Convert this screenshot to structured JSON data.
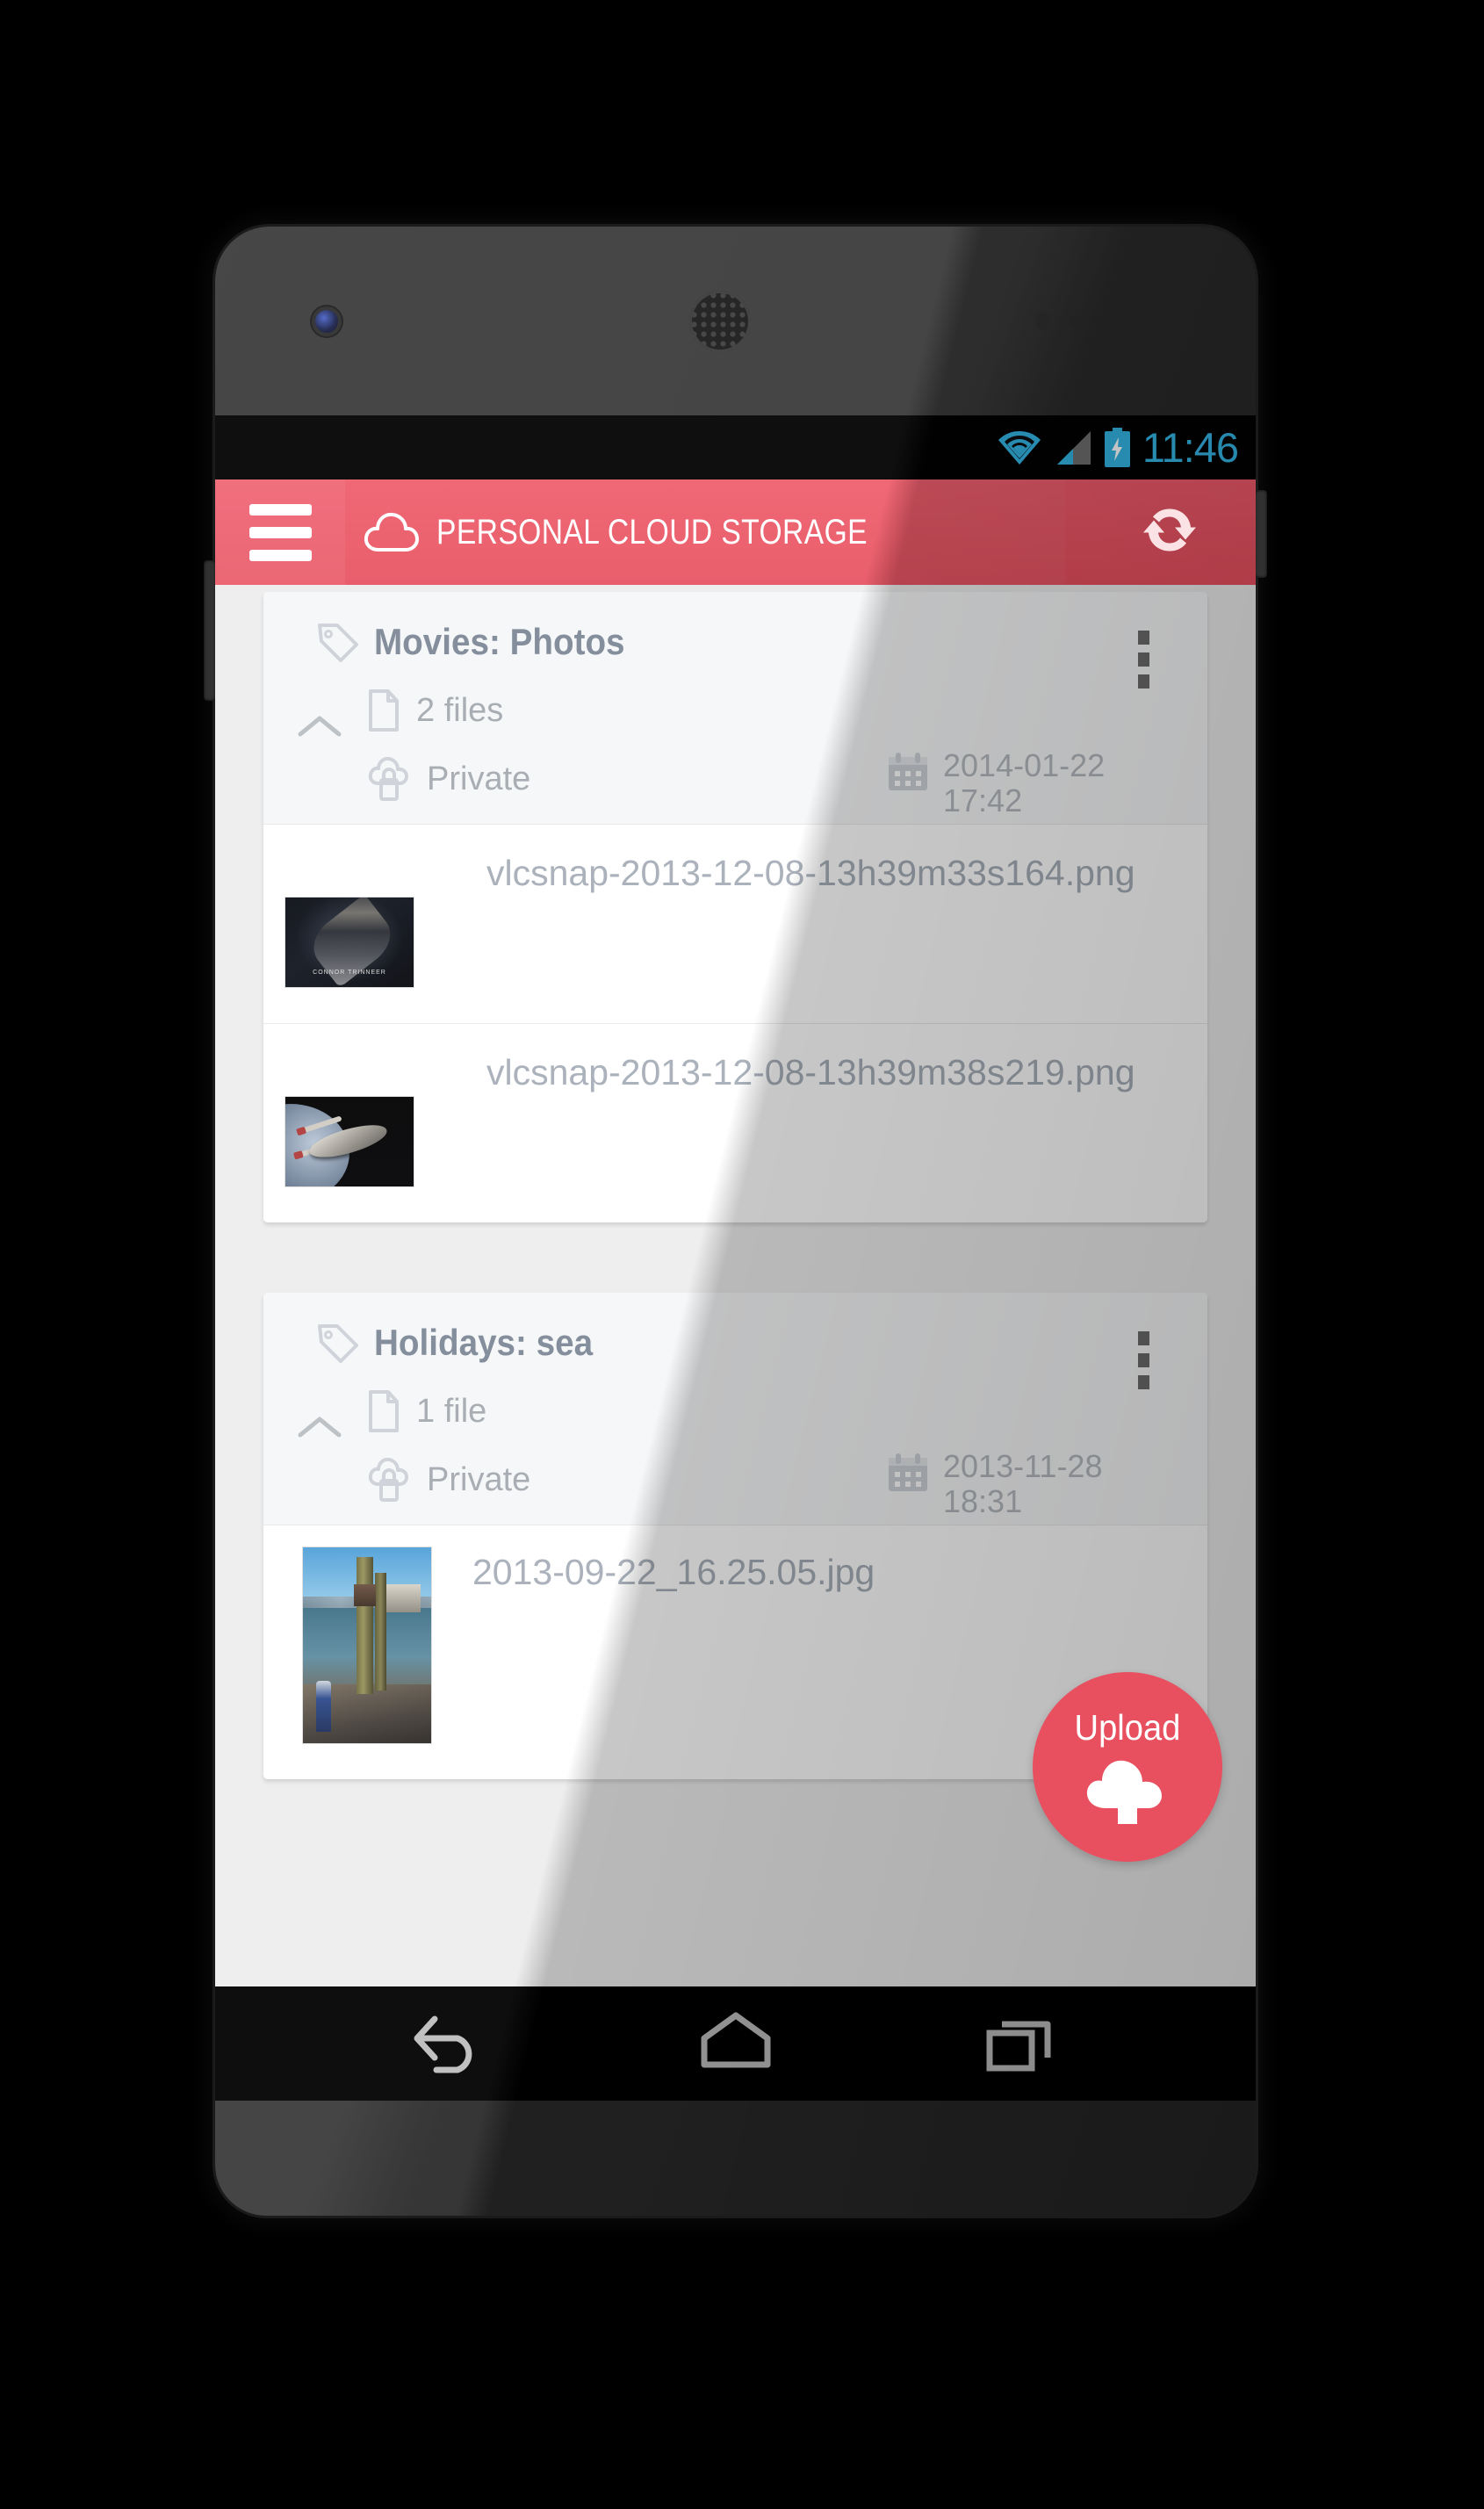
{
  "status_bar": {
    "time": "11:46",
    "time_color": "#33b5e5",
    "icons": [
      "wifi-icon",
      "signal-icon",
      "battery-charging-icon"
    ]
  },
  "app_bar": {
    "menu_icon": "hamburger-menu-icon",
    "logo_icon": "cloud-icon",
    "title": "PERSONAL CLOUD STORAGE",
    "refresh_icon": "refresh-sync-icon",
    "background_color": "#e8505f"
  },
  "cards": [
    {
      "tag_icon": "tag-icon",
      "title": "Movies: Photos",
      "menu_icon": "kebab-menu-icon",
      "collapse_icon": "chevron-up-icon",
      "file_count_icon": "document-icon",
      "file_count": "2 files",
      "privacy_icon": "cloud-lock-icon",
      "privacy": "Private",
      "date_icon": "calendar-icon",
      "date": "2014-01-22",
      "time": "17:42",
      "files": [
        {
          "name": "vlcsnap-2013-12-08-13h39m33s164.png",
          "thumb": "scifi-ship-thumbnail",
          "caption": "CONNOR TRINNEER"
        },
        {
          "name": "vlcsnap-2013-12-08-13h39m38s219.png",
          "thumb": "starship-planet-thumbnail",
          "caption": ""
        }
      ]
    },
    {
      "tag_icon": "tag-icon",
      "title": "Holidays: sea",
      "menu_icon": "kebab-menu-icon",
      "collapse_icon": "chevron-up-icon",
      "file_count_icon": "document-icon",
      "file_count": "1 file",
      "privacy_icon": "cloud-lock-icon",
      "privacy": "Private",
      "date_icon": "calendar-icon",
      "date": "2013-11-28",
      "time": "18:31",
      "files": [
        {
          "name": "2013-09-22_16.25.05.jpg",
          "thumb": "seaside-pier-thumbnail",
          "caption": ""
        }
      ]
    }
  ],
  "fab": {
    "label": "Upload",
    "icon": "cloud-upload-icon",
    "color": "#e8505f"
  },
  "nav_bar": {
    "back_icon": "back-arrow-icon",
    "home_icon": "home-icon",
    "recents_icon": "recent-apps-icon"
  }
}
